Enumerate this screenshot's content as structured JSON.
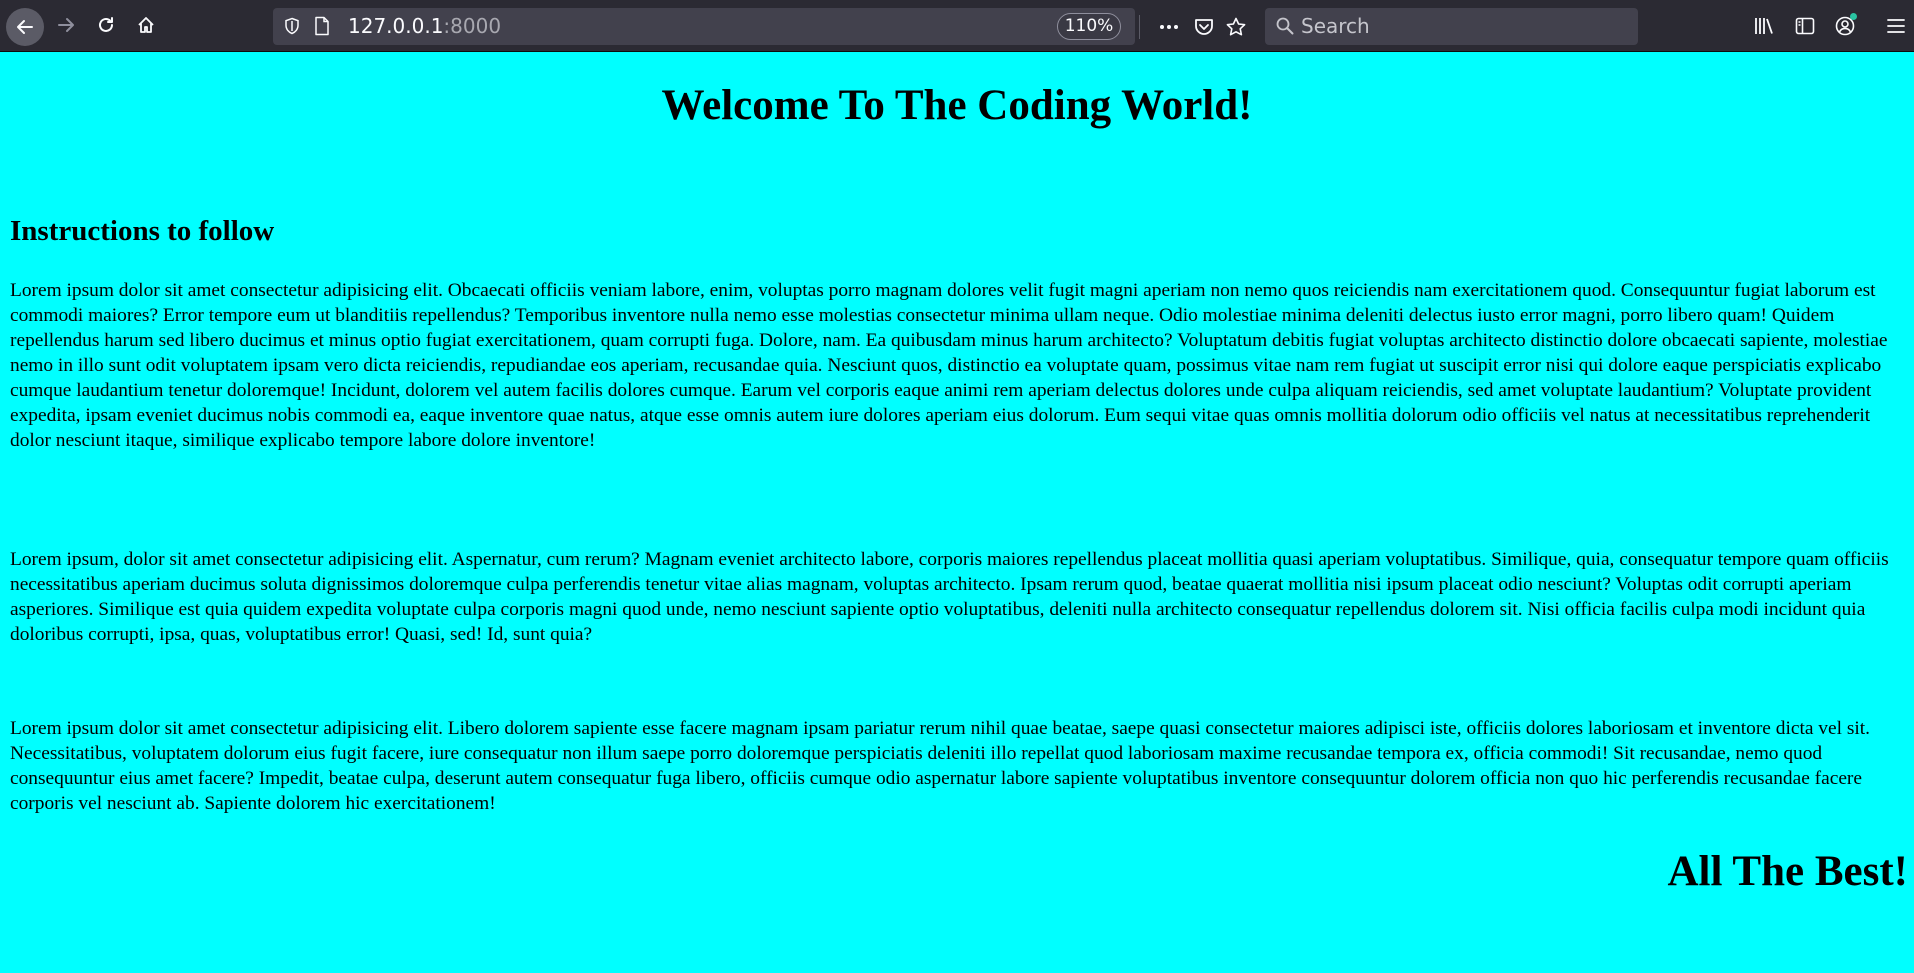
{
  "browser": {
    "url_host": "127.0.0.1",
    "url_port": ":8000",
    "zoom": "110%",
    "search_placeholder": "Search",
    "icons": [
      "back-icon",
      "forward-icon",
      "reload-icon",
      "home-icon",
      "shield-icon",
      "page-icon",
      "more-icon",
      "pocket-icon",
      "star-icon",
      "search-icon",
      "library-icon",
      "sidebar-icon",
      "account-icon",
      "menu-icon"
    ]
  },
  "page": {
    "background": "#00ffff",
    "title": "Welcome To The Coding World!",
    "section_heading": "Instructions to follow",
    "paragraphs": [
      "Lorem ipsum dolor sit amet consectetur adipisicing elit. Obcaecati officiis veniam labore, enim, voluptas porro magnam dolores velit fugit magni aperiam non nemo quos reiciendis nam exercitationem quod. Consequuntur fugiat laborum est commodi maiores? Error tempore eum ut blanditiis repellendus? Temporibus inventore nulla nemo esse molestias consectetur minima ullam neque. Odio molestiae minima deleniti delectus iusto error magni, porro libero quam! Quidem repellendus harum sed libero ducimus et minus optio fugiat exercitationem, quam corrupti fuga. Dolore, nam. Ea quibusdam minus harum architecto? Voluptatum debitis fugiat voluptas architecto distinctio dolore obcaecati sapiente, molestiae nemo in illo sunt odit voluptatem ipsam vero dicta reiciendis, repudiandae eos aperiam, recusandae quia. Nesciunt quos, distinctio ea voluptate quam, possimus vitae nam rem fugiat ut suscipit error nisi qui dolore eaque perspiciatis explicabo cumque laudantium tenetur doloremque! Incidunt, dolorem vel autem facilis dolores cumque. Earum vel corporis eaque animi rem aperiam delectus dolores unde culpa aliquam reiciendis, sed amet voluptate laudantium? Voluptate provident expedita, ipsam eveniet ducimus nobis commodi ea, eaque inventore quae natus, atque esse omnis autem iure dolores aperiam eius dolorum. Eum sequi vitae quas omnis mollitia dolorum odio officiis vel natus at necessitatibus reprehenderit dolor nesciunt itaque, similique explicabo tempore labore dolore inventore!",
      "Lorem ipsum, dolor sit amet consectetur adipisicing elit. Aspernatur, cum rerum? Magnam eveniet architecto labore, corporis maiores repellendus placeat mollitia quasi aperiam voluptatibus. Similique, quia, consequatur tempore quam officiis necessitatibus aperiam ducimus soluta dignissimos doloremque culpa perferendis tenetur vitae alias magnam, voluptas architecto. Ipsam rerum quod, beatae quaerat mollitia nisi ipsum placeat odio nesciunt? Voluptas odit corrupti aperiam asperiores. Similique est quia quidem expedita voluptate culpa corporis magni quod unde, nemo nesciunt sapiente optio voluptatibus, deleniti nulla architecto consequatur repellendus dolorem sit. Nisi officia facilis culpa modi incidunt quia doloribus corrupti, ipsa, quas, voluptatibus error! Quasi, sed! Id, sunt quia?",
      "Lorem ipsum dolor sit amet consectetur adipisicing elit. Libero dolorem sapiente esse facere magnam ipsam pariatur rerum nihil quae beatae, saepe quasi consectetur maiores adipisci iste, officiis dolores laboriosam et inventore dicta vel sit. Necessitatibus, voluptatem dolorum eius fugit facere, iure consequatur non illum saepe porro doloremque perspiciatis deleniti illo repellat quod laboriosam maxime recusandae tempora ex, officia commodi! Sit recusandae, nemo quod consequuntur eius amet facere? Impedit, beatae culpa, deserunt autem consequatur fuga libero, officiis cumque odio aspernatur labore sapiente voluptatibus inventore consequuntur dolorem officia non quo hic perferendis recusandae facere corporis vel nesciunt ab. Sapiente dolorem hic exercitationem!"
    ],
    "closing": "All The Best!"
  }
}
